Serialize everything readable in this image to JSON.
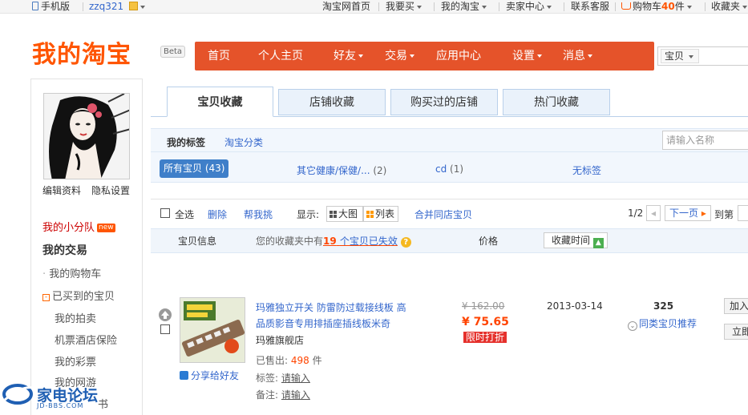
{
  "topbar": {
    "mobile": "手机版",
    "user": "zzq321",
    "home": "淘宝网首页",
    "buy": "我要买",
    "mytaobao": "我的淘宝",
    "seller": "卖家中心",
    "service": "联系客服",
    "cart_label": "购物车",
    "cart_count": "40",
    "cart_unit": "件",
    "favorites": "收藏夹"
  },
  "header": {
    "logo": "我的淘宝",
    "beta": "Beta",
    "nav": [
      "首页",
      "个人主页",
      "好友",
      "交易",
      "应用中心",
      "设置",
      "消息"
    ],
    "search_select": "宝贝"
  },
  "sidebar": {
    "edit_profile": "编辑资料",
    "privacy": "隐私设置",
    "team": "我的小分队",
    "new_badge": "new",
    "trade": "我的交易",
    "cart": "我的购物车",
    "bought": "已买到的宝贝",
    "auction": "我的拍卖",
    "travel": "机票酒店保险",
    "lottery": "我的彩票",
    "games": "我的网游",
    "books": "书"
  },
  "tabs": [
    "宝贝收藏",
    "店铺收藏",
    "购买过的店铺",
    "热门收藏"
  ],
  "filters": {
    "my_tags": "我的标签",
    "taobao_category": "淘宝分类",
    "name_placeholder": "请输入名称",
    "all": "所有宝贝 (43)",
    "cat_health": "其它健康/保健/...",
    "cat_health_count": "(2)",
    "cat_cd": "cd",
    "cat_cd_count": "(1)",
    "untagged": "无标签"
  },
  "toolbar": {
    "select_all": "全选",
    "delete": "删除",
    "help_pick": "帮我挑",
    "display": "显示:",
    "big": "大图",
    "list": "列表",
    "merge": "合并同店宝贝",
    "page": "1/2",
    "next": "下一页",
    "goto": "到第"
  },
  "table_header": {
    "info": "宝贝信息",
    "notice_pre": "您的收藏夹中有",
    "notice_count": "19",
    "notice_post": "个宝贝已失效",
    "price": "价格",
    "fav_time": "收藏时间"
  },
  "item": {
    "title_line1": "玛雅独立开关 防雷防过载接线板 高",
    "title_line2": "品质影音专用排插座插线板米奇",
    "shop": "玛雅旗舰店",
    "sold_label": "已售出:",
    "sold_count": "498",
    "sold_unit": "件",
    "tags_label": "标签:",
    "tags_value": "请输入",
    "note_label": "备注:",
    "note_value": "请输入",
    "old_price": "¥ 162.00",
    "new_price": "¥ 75.65",
    "discount": "限时打折",
    "date": "2013-03-14",
    "popularity": "325",
    "similar": "同类宝贝推荐",
    "share": "分享给好友",
    "add": "加入",
    "buy_now": "立即"
  },
  "watermark": {
    "name": "家电论坛",
    "url": "JD-BBS.COM"
  },
  "colors": {
    "accent": "#e5532a",
    "logo": "#ff5500",
    "link": "#3366cc",
    "price": "#ff4400"
  }
}
